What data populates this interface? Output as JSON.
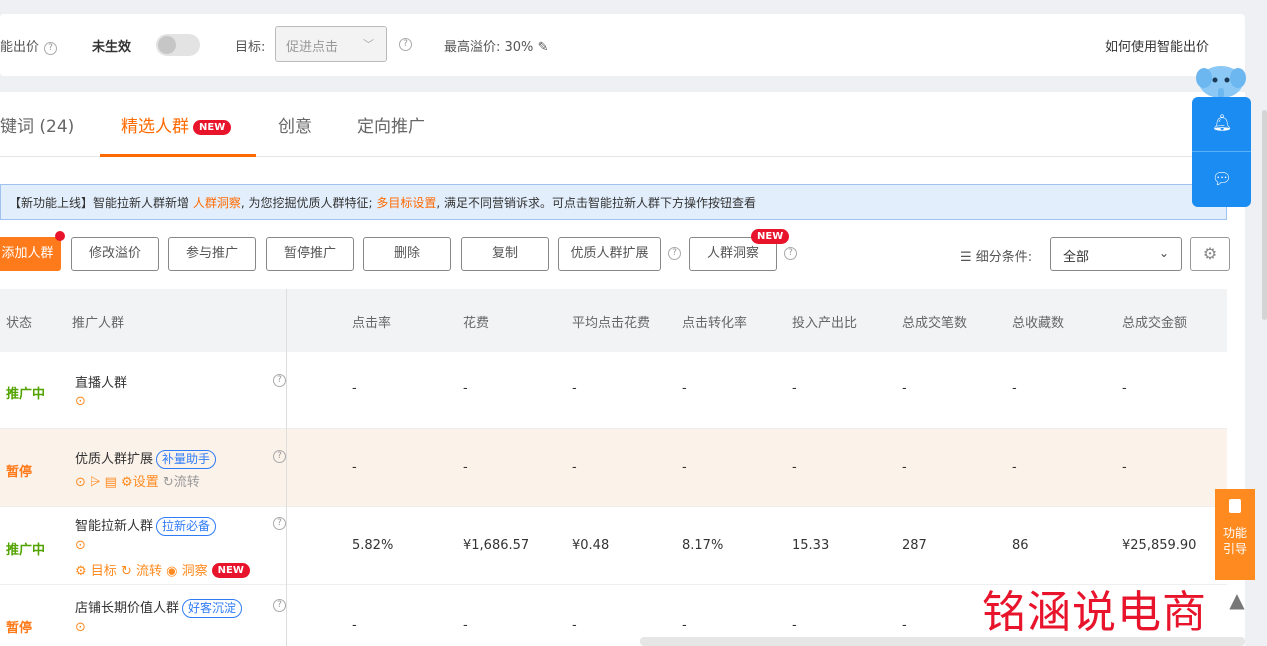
{
  "topbar": {
    "smart_bid_label": "能出价",
    "status_label": "未生效",
    "target_label": "目标:",
    "target_value": "促进点击",
    "max_premium": "最高溢价: 30%",
    "help_link": "如何使用智能出价"
  },
  "tabs": [
    {
      "label": "键词 (24)"
    },
    {
      "label": "精选人群",
      "badge": "NEW"
    },
    {
      "label": "创意"
    },
    {
      "label": "定向推广"
    }
  ],
  "notice": {
    "prefix": "【新功能上线】智能拉新人群新增",
    "link1": "人群洞察",
    "middle": ", 为您挖掘优质人群特征;",
    "link2": "多目标设置",
    "suffix": ", 满足不同营销诉求。可点击智能拉新人群下方操作按钮查看"
  },
  "buttons": {
    "add": "添加人群",
    "modify": "修改溢价",
    "join": "参与推广",
    "pause": "暂停推广",
    "delete": "删除",
    "copy": "复制",
    "expand": "优质人群扩展",
    "insight": "人群洞察",
    "insight_badge": "NEW"
  },
  "filter": {
    "label": "细分条件:",
    "value": "全部"
  },
  "table": {
    "headers": [
      "状态",
      "推广人群",
      "点击率",
      "花费",
      "平均点击花费",
      "点击转化率",
      "投入产出比",
      "总成交笔数",
      "总收藏数",
      "总成交金额"
    ],
    "rows": [
      {
        "status": "推广中",
        "name": "直播人群",
        "tag": "",
        "values": [
          "-",
          "-",
          "-",
          "-",
          "-",
          "-",
          "-",
          "-"
        ]
      },
      {
        "status": "暂停",
        "name": "优质人群扩展",
        "tag": "补量助手",
        "ops": "设置",
        "ops2": "流转",
        "values": [
          "-",
          "-",
          "-",
          "-",
          "-",
          "-",
          "-",
          "-"
        ]
      },
      {
        "status": "推广中",
        "name": "智能拉新人群",
        "tag": "拉新必备",
        "ops": "目标",
        "ops2": "流转",
        "ops3": "洞察",
        "values": [
          "5.82%",
          "¥1,686.57",
          "¥0.48",
          "8.17%",
          "15.33",
          "287",
          "86",
          "¥25,859.90"
        ]
      },
      {
        "status": "暂停",
        "name": "店铺长期价值人群",
        "tag": "好客沉淀",
        "values": [
          "-",
          "-",
          "-",
          "-",
          "-",
          "-",
          "-",
          ""
        ]
      }
    ]
  },
  "guide": {
    "line1": "功能",
    "line2": "引导"
  },
  "watermark": "铭涵说电商"
}
